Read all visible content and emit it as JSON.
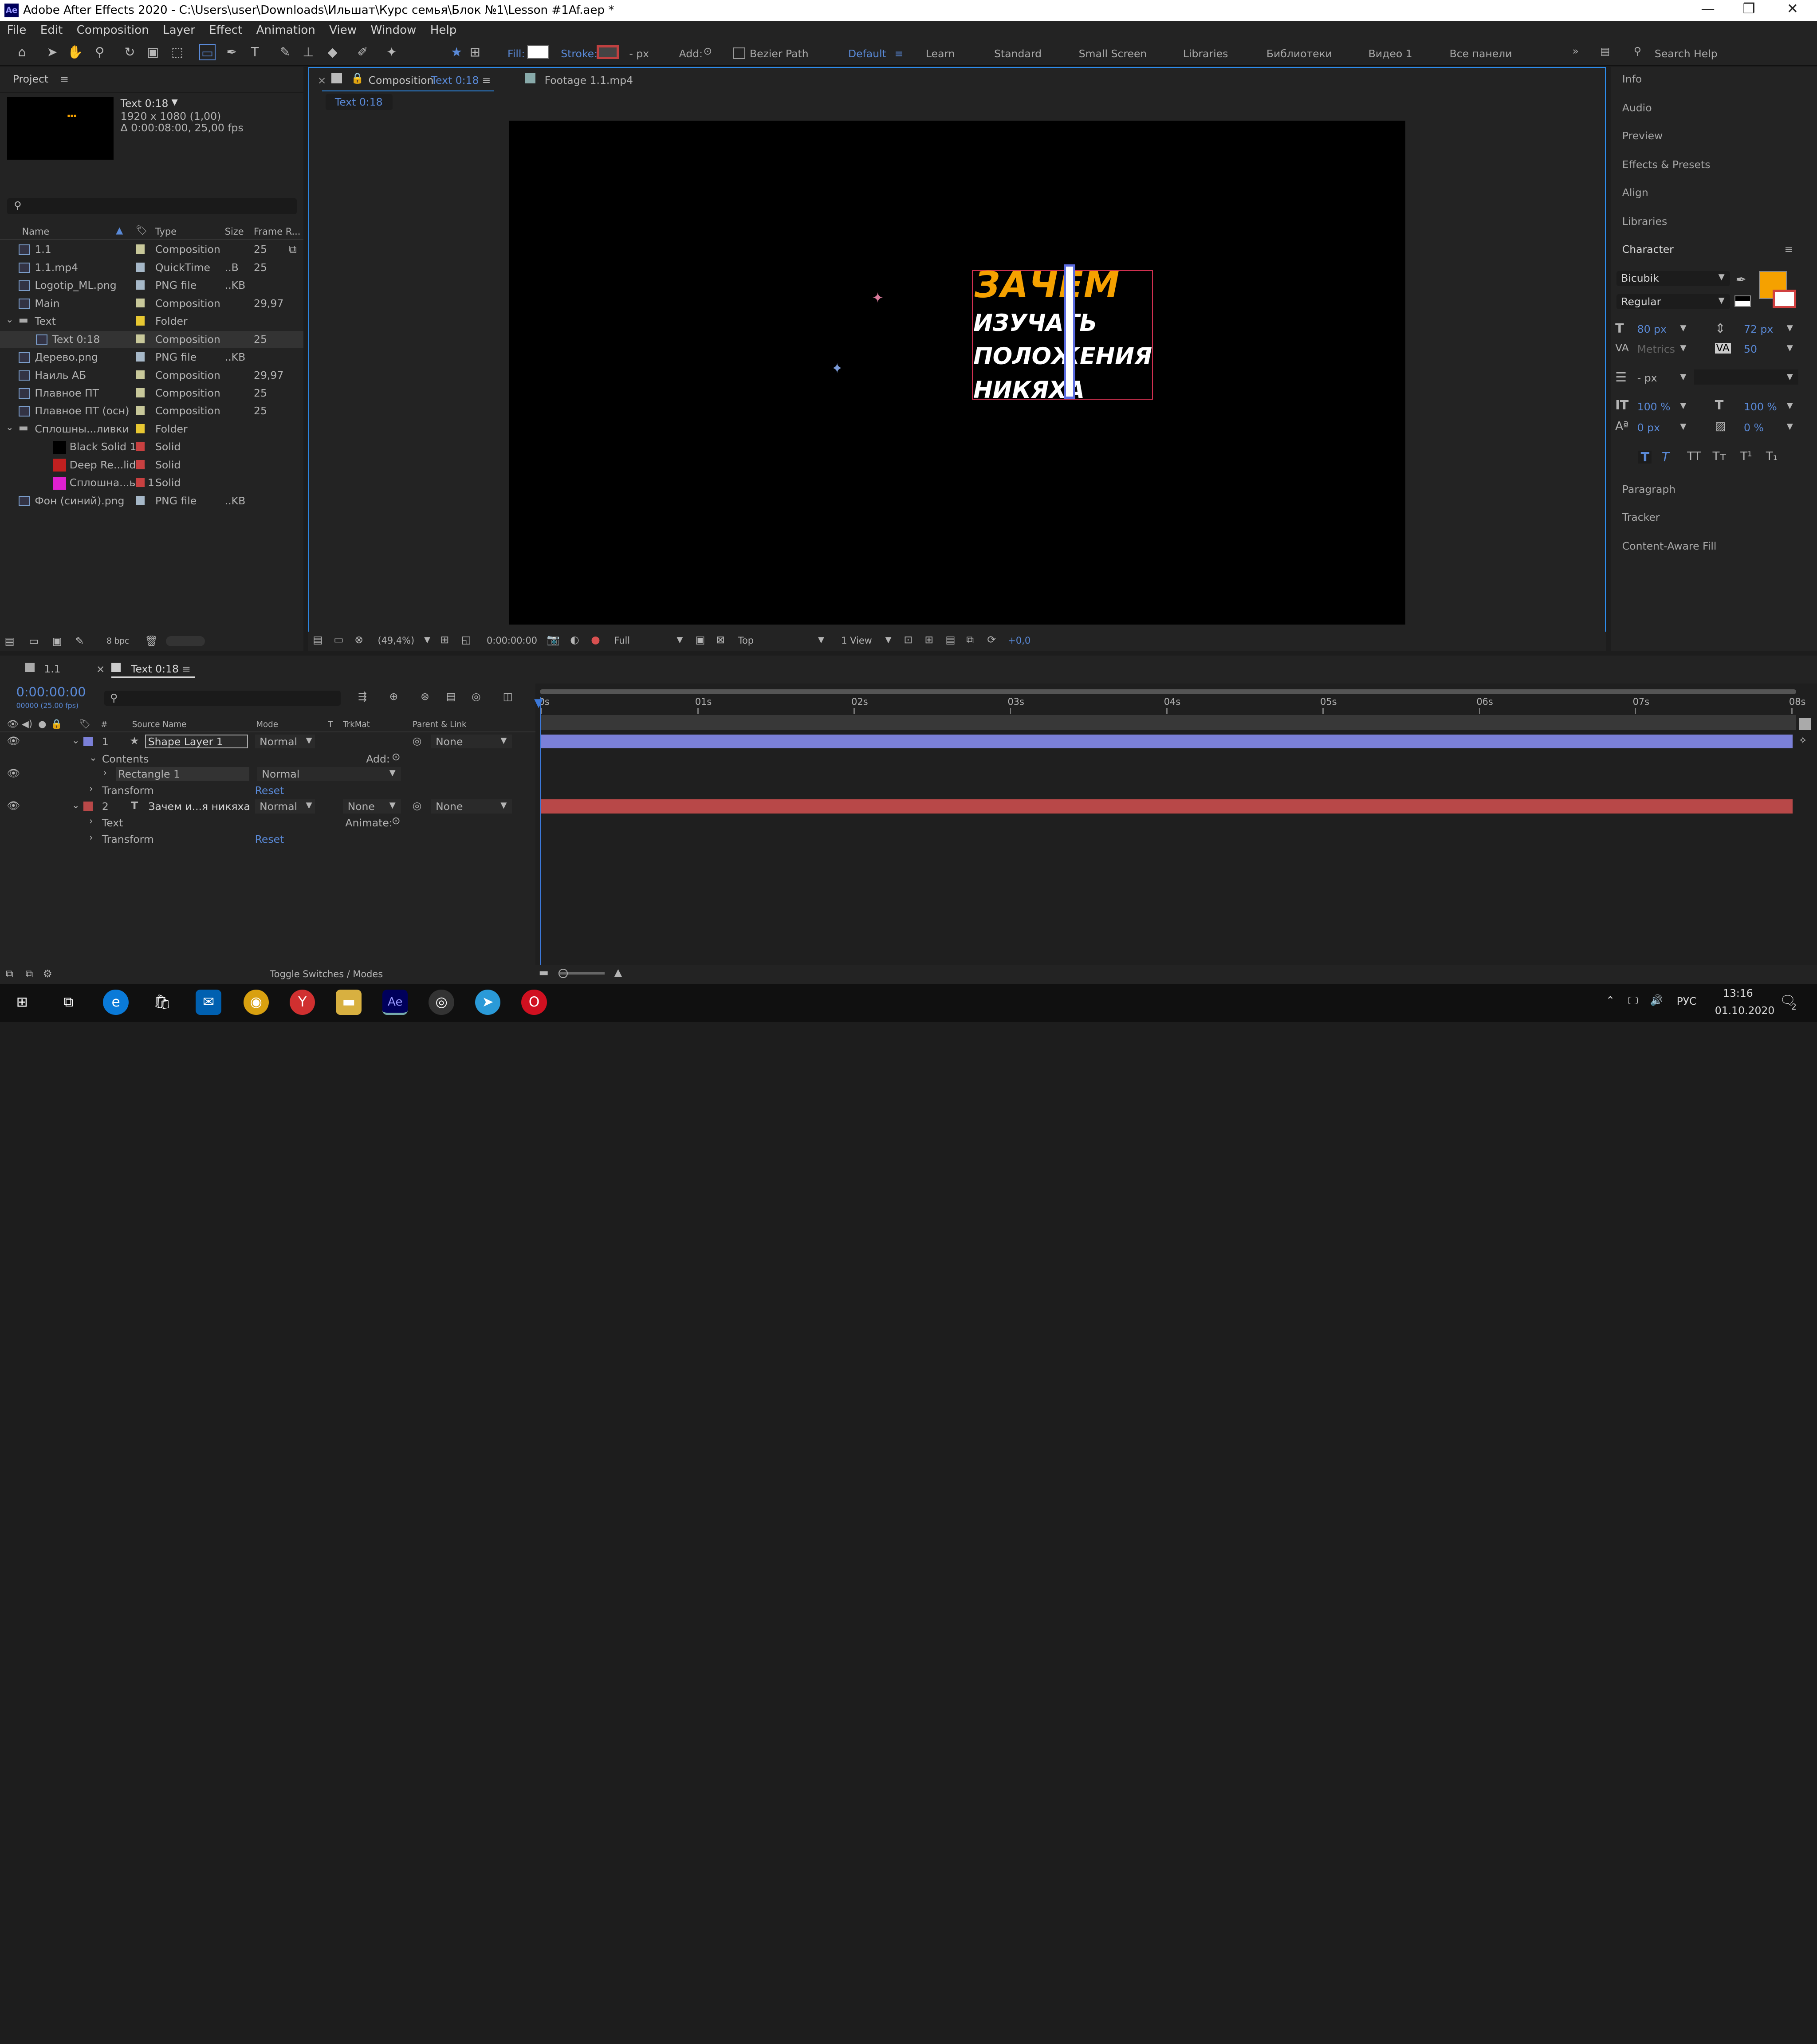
{
  "window": {
    "title": "Adobe After Effects 2020 - C:\\Users\\user\\Downloads\\Ильшат\\Курс семья\\Блок №1\\Lesson #1Af.aep *",
    "app_icon": "Ae"
  },
  "menu": [
    "File",
    "Edit",
    "Composition",
    "Layer",
    "Effect",
    "Animation",
    "View",
    "Window",
    "Help"
  ],
  "toolbar": {
    "fill_label": "Fill:",
    "stroke_label": "Stroke:",
    "stroke_px": "- px",
    "add_label": "Add:",
    "bezier_label": "Bezier Path",
    "workspaces": [
      "Default",
      "Learn",
      "Standard",
      "Small Screen",
      "Libraries",
      "Библиотеки",
      "Видео 1",
      "Все панели"
    ],
    "search_placeholder": "Search Help"
  },
  "project": {
    "tab": "Project",
    "selected_name": "Text 0:18",
    "selected_res": "1920 x 1080 (1,00)",
    "selected_dur": "Δ 0:00:08:00, 25,00 fps",
    "columns": [
      "Name",
      "Type",
      "Size",
      "Frame R..."
    ],
    "items": [
      {
        "name": "1.1",
        "type": "Composition",
        "size": "",
        "fr": "25",
        "color": "#c8c89a",
        "indent": 0
      },
      {
        "name": "1.1.mp4",
        "type": "QuickTime",
        "size": "..B",
        "fr": "25",
        "color": "#a6b8c8",
        "indent": 0
      },
      {
        "name": "Logotip_ML.png",
        "type": "PNG file",
        "size": "..KB",
        "fr": "",
        "color": "#a6b8c8",
        "indent": 0
      },
      {
        "name": "Main",
        "type": "Composition",
        "size": "",
        "fr": "29,97",
        "color": "#c8c89a",
        "indent": 0
      },
      {
        "name": "Text",
        "type": "Folder",
        "size": "",
        "fr": "",
        "color": "#e8c832",
        "indent": 0
      },
      {
        "name": "Text 0:18",
        "type": "Composition",
        "size": "",
        "fr": "25",
        "color": "#c8c89a",
        "indent": 1
      },
      {
        "name": "Дерево.png",
        "type": "PNG file",
        "size": "..KB",
        "fr": "",
        "color": "#a6b8c8",
        "indent": 0
      },
      {
        "name": "Наиль АБ",
        "type": "Composition",
        "size": "",
        "fr": "29,97",
        "color": "#c8c89a",
        "indent": 0
      },
      {
        "name": "Плавное ПТ",
        "type": "Composition",
        "size": "",
        "fr": "25",
        "color": "#c8c89a",
        "indent": 0
      },
      {
        "name": "Плавное ПТ (осн)",
        "type": "Composition",
        "size": "",
        "fr": "25",
        "color": "#c8c89a",
        "indent": 0
      },
      {
        "name": "Сплошны...ливки",
        "type": "Folder",
        "size": "",
        "fr": "",
        "color": "#e8c832",
        "indent": 0
      },
      {
        "name": "Black Solid 1",
        "type": "Solid",
        "size": "",
        "fr": "",
        "color": "#c84040",
        "indent": 2
      },
      {
        "name": "Deep Re...lid 1",
        "type": "Solid",
        "size": "",
        "fr": "",
        "color": "#c84040",
        "indent": 2
      },
      {
        "name": "Сплошна...ый 1",
        "type": "Solid",
        "size": "",
        "fr": "",
        "color": "#c84040",
        "indent": 2
      },
      {
        "name": "Фон (синий).png",
        "type": "PNG file",
        "size": "..KB",
        "fr": "",
        "color": "#a6b8c8",
        "indent": 0
      }
    ],
    "bpc": "8 bpc"
  },
  "comp": {
    "tab": "Composition",
    "tab_name": "Text 0:18",
    "footage_tab": "Footage  1.1.mp4",
    "breadcrumb": "Text 0:18",
    "text_lines": [
      "ЗАЧЕМ",
      "ИЗУЧАТЬ",
      "ПОЛОЖЕНИЯ",
      "НИКЯХА"
    ],
    "zoom": "(49,4%)",
    "time": "0:00:00:00",
    "resolution": "Full",
    "view": "Top",
    "views": "1 View",
    "exposure": "+0,0"
  },
  "right": {
    "top_items": [
      "Info",
      "Audio",
      "Preview",
      "Effects & Presets",
      "Align",
      "Libraries"
    ],
    "character": "Character",
    "font": "Bicubik",
    "style": "Regular",
    "size": "80 px",
    "leading": "72 px",
    "kerning": "Metrics",
    "tracking": "50",
    "stroke": "- px",
    "vscale": "100 %",
    "hscale": "100 %",
    "baseline": "0 px",
    "tsume": "0 %",
    "bottom_items": [
      "Paragraph",
      "Tracker",
      "Content-Aware Fill"
    ],
    "fill_color": "#f5a100"
  },
  "timeline": {
    "tab1": "1.1",
    "tab2": "Text 0:18",
    "timecode": "0:00:00:00",
    "fps": "00000 (25.00 fps)",
    "col_headers": {
      "num": "#",
      "source": "Source Name",
      "mode": "Mode",
      "t": "T",
      "trkmat": "TrkMat",
      "parent": "Parent & Link"
    },
    "layers": [
      {
        "num": "1",
        "name": "Shape Layer 1",
        "mode": "Normal",
        "trkmat": "",
        "parent": "None",
        "color": "#7b80d8"
      },
      {
        "num": "2",
        "name": "Зачем и...я никяха",
        "mode": "Normal",
        "trkmat": "None",
        "parent": "None",
        "color": "#b84848"
      }
    ],
    "contents": "Contents",
    "add": "Add:",
    "rect": "Rectangle 1",
    "rect_mode": "Normal",
    "transform": "Transform",
    "reset": "Reset",
    "text": "Text",
    "animate": "Animate:",
    "ruler": [
      "0s",
      "01s",
      "02s",
      "03s",
      "04s",
      "05s",
      "06s",
      "07s",
      "08s"
    ],
    "toggle": "Toggle Switches / Modes"
  },
  "taskbar": {
    "time": "13:16",
    "date": "01.10.2020",
    "lang": "РУС",
    "notif": "2"
  }
}
